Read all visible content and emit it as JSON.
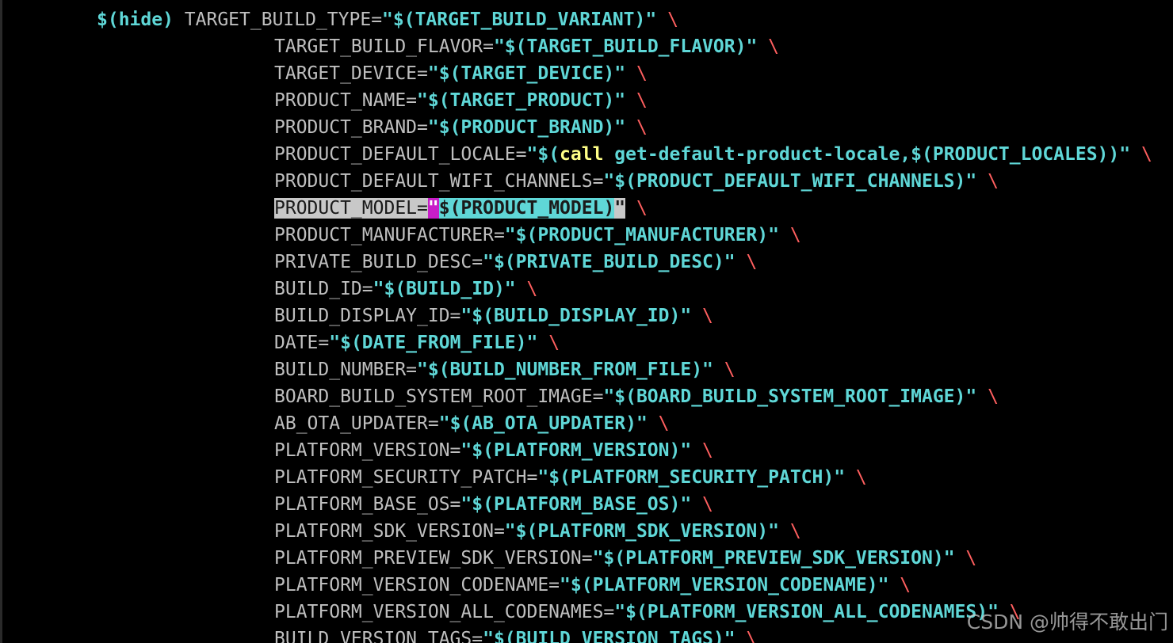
{
  "colors": {
    "background": "#000000",
    "variable_name": "#bfbfbf",
    "expansion": "#5fd7d7",
    "keyword_call": "#ffff87",
    "line_continuation": "#ff5f5f",
    "selection_magenta": "#c81ec8",
    "selection_cyan": "#5fd7d7"
  },
  "first_line": {
    "prefix": "$(hide)",
    "key": "TARGET_BUILD_TYPE=",
    "value": "\"$(TARGET_BUILD_VARIANT)\"",
    "cont": " \\"
  },
  "assignments": [
    {
      "key": "TARGET_BUILD_FLAVOR=",
      "value": "\"$(TARGET_BUILD_FLAVOR)\"",
      "cont": " \\"
    },
    {
      "key": "TARGET_DEVICE=",
      "value": "\"$(TARGET_DEVICE)\"",
      "cont": " \\"
    },
    {
      "key": "PRODUCT_NAME=",
      "value": "\"$(TARGET_PRODUCT)\"",
      "cont": " \\"
    },
    {
      "key": "PRODUCT_BRAND=",
      "value": "\"$(PRODUCT_BRAND)\"",
      "cont": " \\"
    },
    {
      "key": "PRODUCT_DEFAULT_LOCALE=",
      "value_open": "\"$(",
      "call": "call",
      "value_rest": " get-default-product-locale,$(PRODUCT_LOCALES))\"",
      "cont": " \\"
    },
    {
      "key": "PRODUCT_DEFAULT_WIFI_CHANNELS=",
      "value": "\"$(PRODUCT_DEFAULT_WIFI_CHANNELS)\"",
      "cont": " \\"
    },
    {
      "key": "PRODUCT_MODEL=",
      "q_open": "\"",
      "value": "$(PRODUCT_MODEL)",
      "q_close": "\"",
      "cont": " \\",
      "selected": true
    },
    {
      "key": "PRODUCT_MANUFACTURER=",
      "value": "\"$(PRODUCT_MANUFACTURER)\"",
      "cont": " \\"
    },
    {
      "key": "PRIVATE_BUILD_DESC=",
      "value": "\"$(PRIVATE_BUILD_DESC)\"",
      "cont": " \\"
    },
    {
      "key": "BUILD_ID=",
      "value": "\"$(BUILD_ID)\"",
      "cont": " \\"
    },
    {
      "key": "BUILD_DISPLAY_ID=",
      "value": "\"$(BUILD_DISPLAY_ID)\"",
      "cont": " \\"
    },
    {
      "key": "DATE=",
      "value": "\"$(DATE_FROM_FILE)\"",
      "cont": " \\"
    },
    {
      "key": "BUILD_NUMBER=",
      "value": "\"$(BUILD_NUMBER_FROM_FILE)\"",
      "cont": " \\"
    },
    {
      "key": "BOARD_BUILD_SYSTEM_ROOT_IMAGE=",
      "value": "\"$(BOARD_BUILD_SYSTEM_ROOT_IMAGE)\"",
      "cont": " \\"
    },
    {
      "key": "AB_OTA_UPDATER=",
      "value": "\"$(AB_OTA_UPDATER)\"",
      "cont": " \\"
    },
    {
      "key": "PLATFORM_VERSION=",
      "value": "\"$(PLATFORM_VERSION)\"",
      "cont": " \\"
    },
    {
      "key": "PLATFORM_SECURITY_PATCH=",
      "value": "\"$(PLATFORM_SECURITY_PATCH)\"",
      "cont": " \\"
    },
    {
      "key": "PLATFORM_BASE_OS=",
      "value": "\"$(PLATFORM_BASE_OS)\"",
      "cont": " \\"
    },
    {
      "key": "PLATFORM_SDK_VERSION=",
      "value": "\"$(PLATFORM_SDK_VERSION)\"",
      "cont": " \\"
    },
    {
      "key": "PLATFORM_PREVIEW_SDK_VERSION=",
      "value": "\"$(PLATFORM_PREVIEW_SDK_VERSION)\"",
      "cont": " \\"
    },
    {
      "key": "PLATFORM_VERSION_CODENAME=",
      "value": "\"$(PLATFORM_VERSION_CODENAME)\"",
      "cont": " \\"
    },
    {
      "key": "PLATFORM_VERSION_ALL_CODENAMES=",
      "value": "\"$(PLATFORM_VERSION_ALL_CODENAMES)\"",
      "cont": " \\"
    },
    {
      "key": "BUILD_VERSION_TAGS=",
      "value": "\"$(BUILD_VERSION_TAGS)\"",
      "cont": " \\"
    }
  ],
  "watermark": "CSDN @帅得不敢出门"
}
